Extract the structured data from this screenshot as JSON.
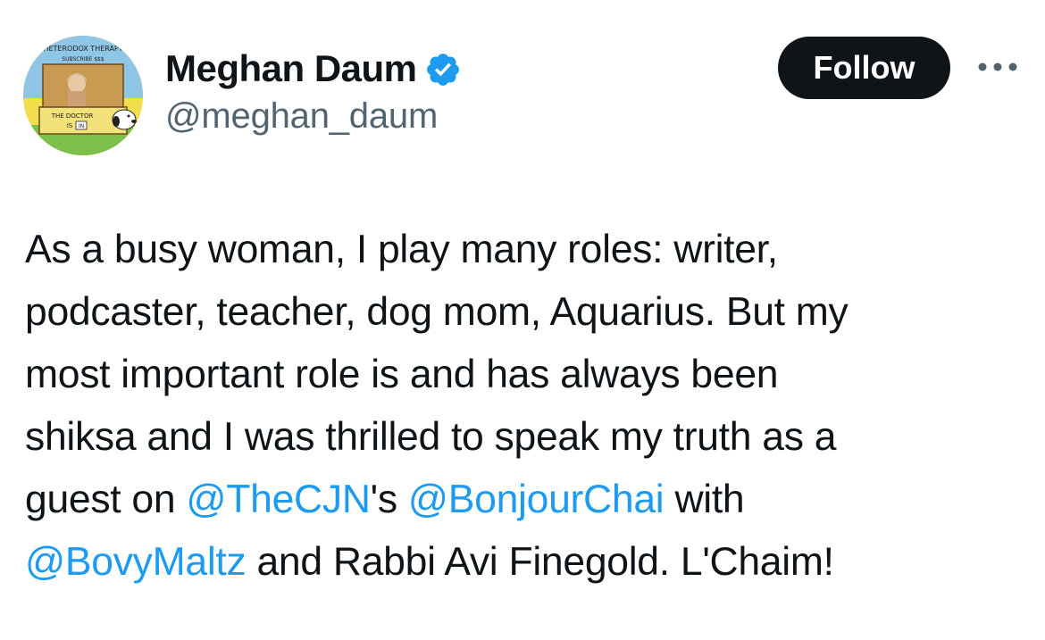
{
  "author": {
    "display_name": "Meghan Daum",
    "handle": "@meghan_daum",
    "verified": true,
    "avatar_icon": "avatar-image",
    "avatar_text": {
      "top_line": "HETERODOX THERAPY",
      "sub_line": "SUBSCRIBE $$$",
      "booth_line1": "THE DOCTOR",
      "booth_line2": "IS",
      "booth_sign": "IN"
    }
  },
  "actions": {
    "follow_label": "Follow",
    "more_icon": "more-horizontal-icon"
  },
  "tweet": {
    "lines": [
      [
        {
          "t": "text",
          "v": "As a busy woman, I play many roles: writer,"
        }
      ],
      [
        {
          "t": "text",
          "v": "podcaster, teacher, dog mom, Aquarius. But my"
        }
      ],
      [
        {
          "t": "text",
          "v": "most important role is and has always been"
        }
      ],
      [
        {
          "t": "text",
          "v": "shiksa and I was thrilled to speak my truth as a"
        }
      ],
      [
        {
          "t": "text",
          "v": "guest on "
        },
        {
          "t": "mention",
          "v": "@TheCJN"
        },
        {
          "t": "text",
          "v": "'s "
        },
        {
          "t": "mention",
          "v": "@BonjourChai"
        },
        {
          "t": "text",
          "v": " with"
        }
      ],
      [
        {
          "t": "mention",
          "v": "@BovyMaltz"
        },
        {
          "t": "text",
          "v": " and Rabbi Avi Finegold. L'Chaim!"
        }
      ]
    ]
  },
  "colors": {
    "text": "#0f1419",
    "secondary": "#536471",
    "link": "#1d9bf0",
    "follow_bg": "#0f1419",
    "follow_text": "#ffffff",
    "verified": "#1d9bf0"
  }
}
